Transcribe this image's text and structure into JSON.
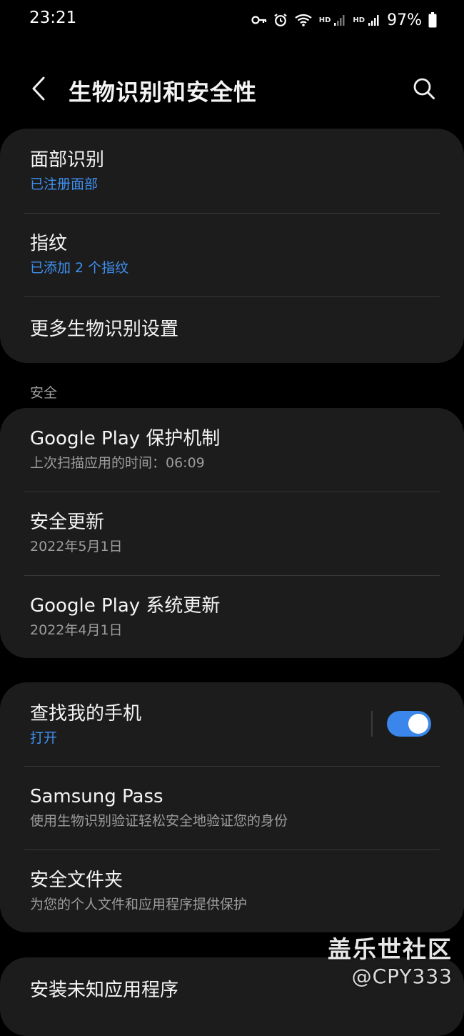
{
  "status_bar": {
    "time": "23:21",
    "hd_1": "HD",
    "hd_2": "HD",
    "battery": "97%",
    "icons": [
      "vpn-key-icon",
      "alarm-icon",
      "wifi-icon",
      "signal-icon",
      "signal-icon",
      "battery-icon"
    ]
  },
  "header": {
    "title": "生物识别和安全性"
  },
  "biometrics": {
    "face": {
      "title": "面部识别",
      "subtitle": "已注册面部"
    },
    "fingerprint": {
      "title": "指纹",
      "subtitle": "已添加 2 个指纹"
    },
    "more": {
      "title": "更多生物识别设置"
    }
  },
  "security": {
    "section_label": "安全",
    "play_protect": {
      "title": "Google Play 保护机制",
      "subtitle": "上次扫描应用的时间：06:09"
    },
    "security_update": {
      "title": "安全更新",
      "subtitle": "2022年5月1日"
    },
    "play_system_update": {
      "title": "Google Play 系统更新",
      "subtitle": "2022年4月1日"
    }
  },
  "device": {
    "find_my_mobile": {
      "title": "查找我的手机",
      "subtitle": "打开",
      "enabled": true
    },
    "samsung_pass": {
      "title": "Samsung Pass",
      "subtitle": "使用生物识别验证轻松安全地验证您的身份"
    },
    "secure_folder": {
      "title": "安全文件夹",
      "subtitle": "为您的个人文件和应用程序提供保护"
    }
  },
  "install_unknown": {
    "title": "安装未知应用程序"
  },
  "watermark": {
    "line1": "盖乐世社区",
    "line2": "@CPY333"
  },
  "colors": {
    "background": "#000000",
    "card": "#1c1c1c",
    "accent": "#3f90f0",
    "toggle_on": "#3a86ea",
    "secondary_text": "#9c9c9c"
  }
}
